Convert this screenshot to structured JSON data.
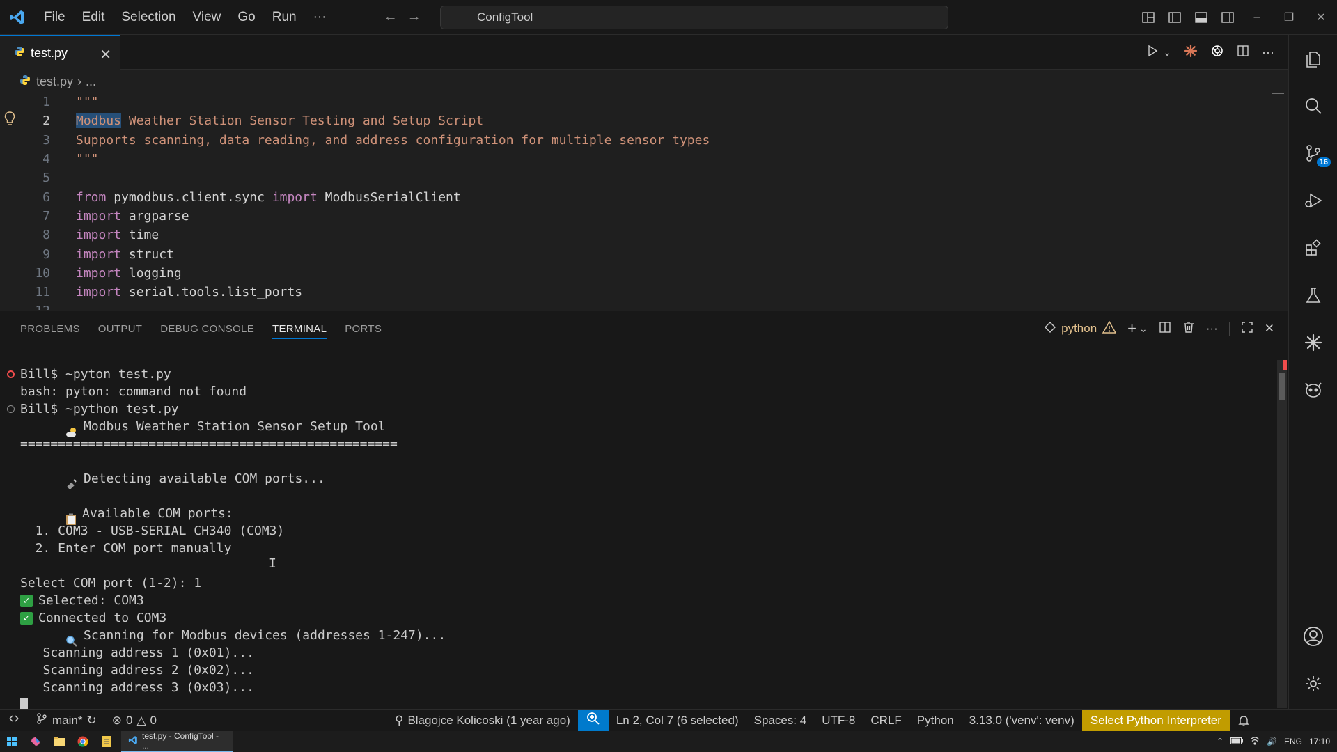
{
  "titlebar": {
    "menu": [
      "File",
      "Edit",
      "Selection",
      "View",
      "Go",
      "Run",
      "···"
    ],
    "search_text": "ConfigTool"
  },
  "editor": {
    "tab_label": "test.py",
    "breadcrumb_file": "test.py",
    "breadcrumb_rest": "...",
    "lines": [
      {
        "n": "1",
        "text": "\"\"\""
      },
      {
        "n": "2",
        "text": "Modbus Weather Station Sensor Testing and Setup Script"
      },
      {
        "n": "3",
        "text": "Supports scanning, data reading, and address configuration for multiple sensor types"
      },
      {
        "n": "4",
        "text": "\"\"\""
      },
      {
        "n": "5",
        "text": ""
      },
      {
        "n": "6",
        "kw1": "from",
        "a": " pymodbus.client.sync ",
        "kw2": "import",
        "b": " ModbusSerialClient"
      },
      {
        "n": "7",
        "kw1": "import",
        "a": " argparse"
      },
      {
        "n": "8",
        "kw1": "import",
        "a": " time"
      },
      {
        "n": "9",
        "kw1": "import",
        "a": " struct"
      },
      {
        "n": "10",
        "kw1": "import",
        "a": " logging"
      },
      {
        "n": "11",
        "kw1": "import",
        "a": " serial.tools.list_ports"
      },
      {
        "n": "12",
        "text": ""
      }
    ]
  },
  "panel": {
    "tabs": [
      "PROBLEMS",
      "OUTPUT",
      "DEBUG CONSOLE",
      "TERMINAL",
      "PORTS"
    ],
    "active_tab": "TERMINAL",
    "terminal_name": "python"
  },
  "terminal": {
    "l1": "Bill$ ~pyton test.py",
    "l2": "bash: pyton: command not found",
    "l3": "Bill$ ~python test.py",
    "l4": "Modbus Weather Station Sensor Setup Tool",
    "l5": "==================================================",
    "l6": "",
    "l7": "Detecting available COM ports...",
    "l8": "",
    "l9": "Available COM ports:",
    "l10": "  1. COM3 - USB-SERIAL CH340 (COM3)",
    "l11": "  2. Enter COM port manually",
    "l12": "",
    "l13": "Select COM port (1-2): 1",
    "l14": "Selected: COM3",
    "l15": "Connected to COM3",
    "l16": "Scanning for Modbus devices (addresses 1-247)...",
    "l17": "   Scanning address 1 (0x01)...",
    "l18": "   Scanning address 2 (0x02)...",
    "l19": "   Scanning address 3 (0x03)..."
  },
  "activity": {
    "scm_badge": "16"
  },
  "statusbar": {
    "branch": "main*",
    "errors": "0",
    "warnings": "0",
    "blame": "Blagojce Kolicoski (1 year ago)",
    "position": "Ln 2, Col 7 (6 selected)",
    "spaces": "Spaces: 4",
    "encoding": "UTF-8",
    "eol": "CRLF",
    "language": "Python",
    "interpreter": "3.13.0 ('venv': venv)",
    "select_interpreter": "Select Python Interpreter"
  },
  "taskbar": {
    "task_label": "test.py - ConfigTool - ...",
    "lang": "ENG",
    "time": "17:10"
  },
  "colors": {
    "accent": "#0078d4",
    "keyword": "#c586c0",
    "string": "#ce9178",
    "highlight": "#c19c00"
  }
}
